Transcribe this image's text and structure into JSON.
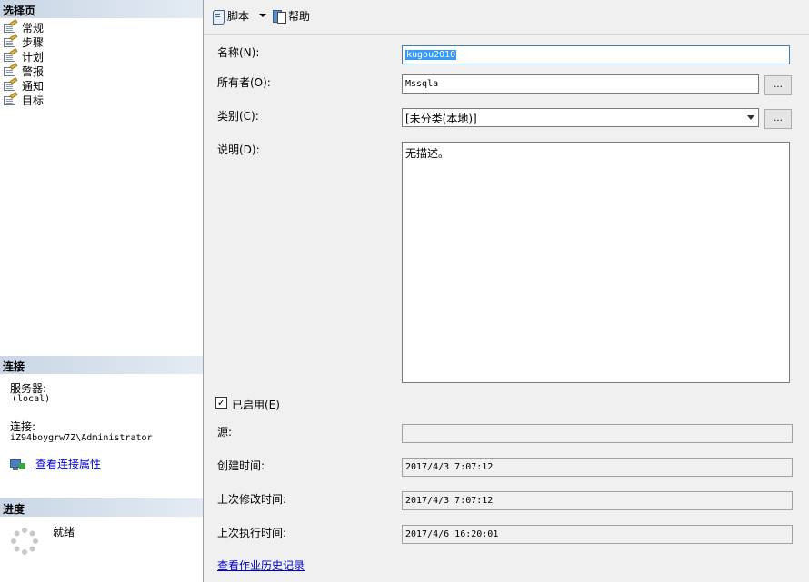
{
  "left_pane": {
    "select_page_header": "选择页",
    "pages": [
      {
        "label": "常规"
      },
      {
        "label": "步骤"
      },
      {
        "label": "计划"
      },
      {
        "label": "警报"
      },
      {
        "label": "通知"
      },
      {
        "label": "目标"
      }
    ],
    "connection_header": "连接",
    "server_label": "服务器:",
    "server_value": "(local)",
    "connection_label": "连接:",
    "connection_value": "iZ94boygrw7Z\\Administrator",
    "view_connection_link": "查看连接属性",
    "progress_header": "进度",
    "progress_status": "就绪"
  },
  "toolbar": {
    "script_label": "脚本",
    "help_label": "帮助"
  },
  "form": {
    "name_label": "名称(N):",
    "name_value": "kugou2010",
    "owner_label": "所有者(O):",
    "owner_value": "Mssqla",
    "owner_browse": "...",
    "category_label": "类别(C):",
    "category_value": "[未分类(本地)]",
    "category_browse": "...",
    "description_label": "说明(D):",
    "description_value": "无描述。",
    "enabled_label": "已启用(E)",
    "enabled_checked": true,
    "enabled_mark": "✓",
    "source_label": "源:",
    "source_value": "",
    "created_label": "创建时间:",
    "created_value": "2017/4/3 7:07:12",
    "modified_label": "上次修改时间:",
    "modified_value": "2017/4/3 7:07:12",
    "executed_label": "上次执行时间:",
    "executed_value": "2017/4/6 16:20:01",
    "history_link": "查看作业历史记录"
  }
}
